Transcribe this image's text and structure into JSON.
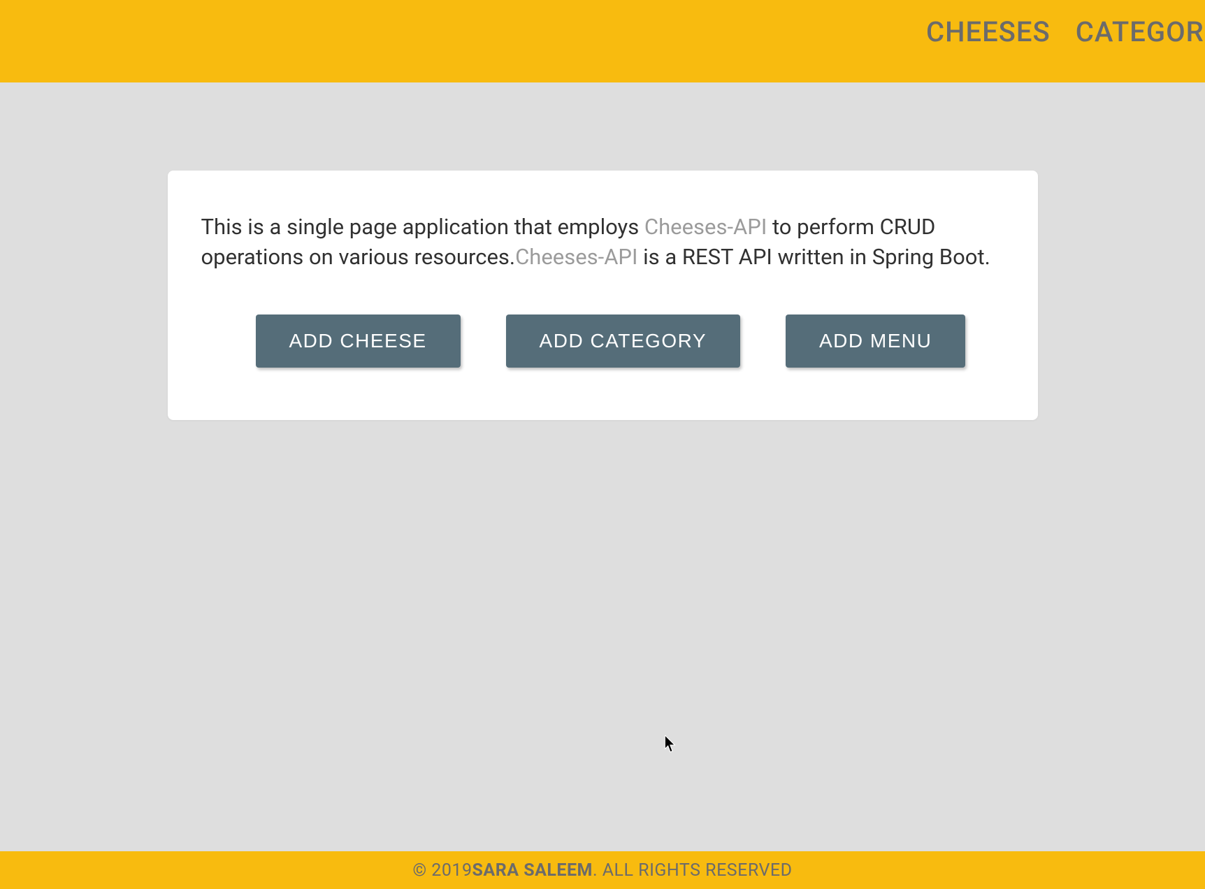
{
  "nav": {
    "items": [
      {
        "label": "CHEESES"
      },
      {
        "label": "CATEGORIES"
      }
    ]
  },
  "card": {
    "desc_part1": "This is a single page application that employs ",
    "desc_link1": "Cheeses-API",
    "desc_part2": " to perform CRUD operations on various resources.",
    "desc_link2": "Cheeses-API",
    "desc_part3": " is a REST API written in Spring Boot.",
    "buttons": {
      "add_cheese": "ADD CHEESE",
      "add_category": "ADD CATEGORY",
      "add_menu": "ADD MENU"
    }
  },
  "footer": {
    "copyright_prefix": "© 2019 ",
    "author": "SARA SALEEM",
    "suffix": ". ALL RIGHTS RESERVED"
  },
  "colors": {
    "accent": "#f8bb0f",
    "button": "#556d79",
    "page_bg": "#dedede",
    "nav_text": "#6b6b6b"
  }
}
